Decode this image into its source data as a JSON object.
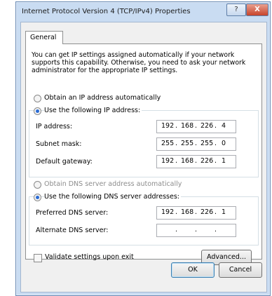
{
  "window": {
    "title": "Internet Protocol Version 4 (TCP/IPv4) Properties",
    "help_glyph": "?",
    "close_glyph": "X"
  },
  "tabs": {
    "general": "General"
  },
  "intro_text": "You can get IP settings assigned automatically if your network supports this capability. Otherwise, you need to ask your network administrator for the appropriate IP settings.",
  "ip_section": {
    "auto_label": "Obtain an IP address automatically",
    "manual_label": "Use the following IP address:",
    "selected": "manual",
    "fields": [
      {
        "label": "IP address:",
        "octets": [
          "192",
          "168",
          "226",
          "4"
        ]
      },
      {
        "label": "Subnet mask:",
        "octets": [
          "255",
          "255",
          "255",
          "0"
        ]
      },
      {
        "label": "Default gateway:",
        "octets": [
          "192",
          "168",
          "226",
          "1"
        ]
      }
    ]
  },
  "dns_section": {
    "auto_label": "Obtain DNS server address automatically",
    "manual_label": "Use the following DNS server addresses:",
    "selected": "manual",
    "fields": [
      {
        "label": "Preferred DNS server:",
        "octets": [
          "192",
          "168",
          "226",
          "1"
        ]
      },
      {
        "label": "Alternate DNS server:",
        "octets": [
          "",
          "",
          "",
          ""
        ]
      }
    ]
  },
  "validate_label": "Validate settings upon exit",
  "validate_checked": false,
  "buttons": {
    "advanced": "Advanced...",
    "ok": "OK",
    "cancel": "Cancel"
  },
  "ip_separator": "."
}
